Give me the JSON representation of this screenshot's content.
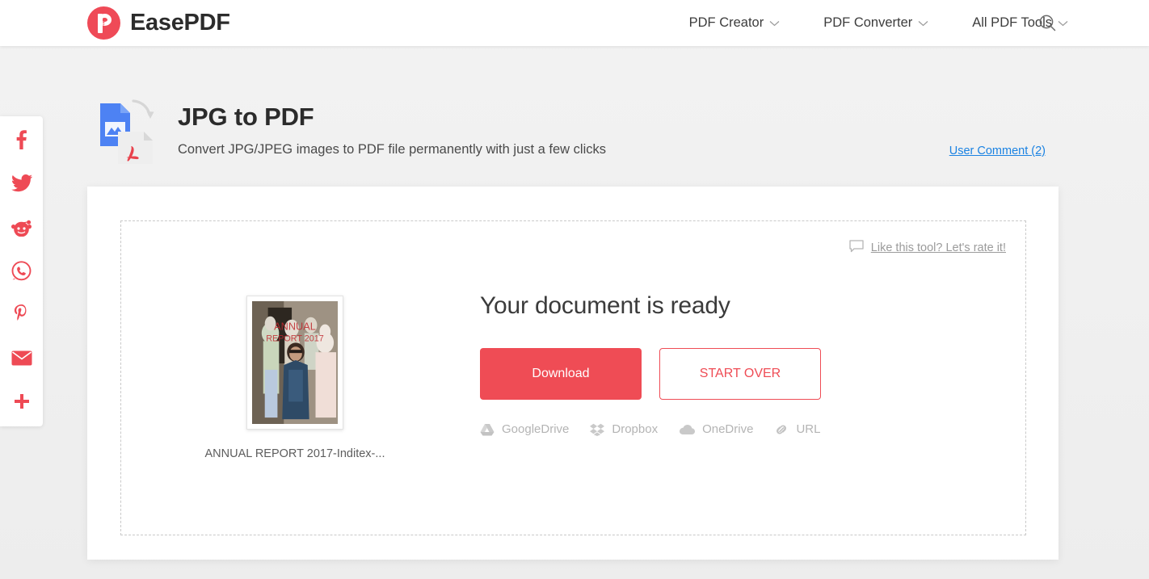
{
  "header": {
    "brand_name": "EasePDF",
    "logo_icon": "easepdf-logo-icon",
    "nav": [
      {
        "label": "PDF Creator",
        "icon": "chevron-down-icon"
      },
      {
        "label": "PDF Converter",
        "icon": "chevron-down-icon"
      },
      {
        "label": "All PDF Tools",
        "icon": "chevron-down-icon"
      }
    ],
    "search_icon": "search-icon"
  },
  "share_rail": [
    {
      "name": "facebook-icon",
      "label": "Facebook"
    },
    {
      "name": "twitter-icon",
      "label": "Twitter"
    },
    {
      "name": "reddit-icon",
      "label": "Reddit"
    },
    {
      "name": "whatsapp-icon",
      "label": "WhatsApp"
    },
    {
      "name": "pinterest-icon",
      "label": "Pinterest"
    },
    {
      "name": "email-icon",
      "label": "Email"
    },
    {
      "name": "more-share-icon",
      "label": "More"
    }
  ],
  "tool": {
    "icon": "jpg-to-pdf-icon",
    "title": "JPG to PDF",
    "subtitle": "Convert JPG/JPEG images to PDF file permanently with just a few clicks",
    "user_comment_link": "User Comment (2)"
  },
  "card": {
    "rate": {
      "icon": "comment-bubble-icon",
      "text": "Like this tool? Let's rate it!"
    },
    "result": {
      "thumbnail": {
        "caption": "ANNUAL REPORT 2017-Inditex-...",
        "overlay_line1": "ANNUAL",
        "overlay_line2": "REPORT 2017"
      },
      "heading": "Your document is ready",
      "download_label": "Download",
      "start_over_label": "START OVER",
      "cloud_targets": [
        {
          "label": "GoogleDrive",
          "icon": "google-drive-icon"
        },
        {
          "label": "Dropbox",
          "icon": "dropbox-icon"
        },
        {
          "label": "OneDrive",
          "icon": "onedrive-icon"
        },
        {
          "label": "URL",
          "icon": "link-icon"
        }
      ]
    }
  },
  "colors": {
    "brand_red": "#ef4c55",
    "link_blue": "#1a82e2",
    "page_bg": "#eeeeee",
    "muted_gray": "#b4b4b4"
  }
}
